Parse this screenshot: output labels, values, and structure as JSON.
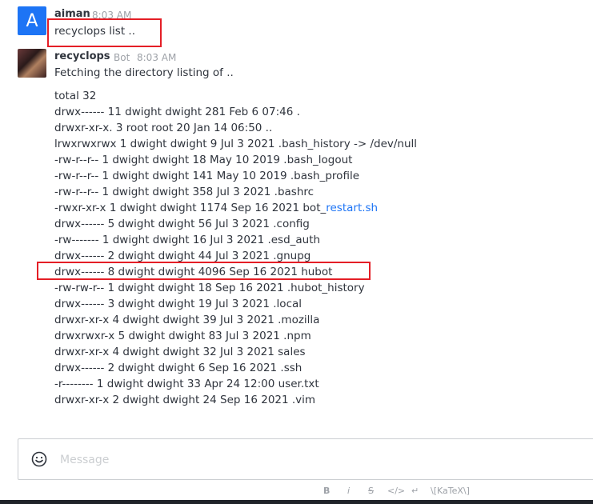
{
  "messages": [
    {
      "avatar_letter": "A",
      "username": "aiman",
      "time": "8:03 AM",
      "text": "recyclops list .."
    },
    {
      "username": "recyclops",
      "badge": "Bot",
      "time": "8:03 AM",
      "text": "Fetching the directory listing of ..",
      "listing": [
        "total 32",
        "drwx------ 11 dwight dwight 281 Feb 6 07:46 .",
        "drwxr-xr-x. 3 root root 20 Jan 14 06:50 ..",
        "lrwxrwxrwx 1 dwight dwight 9 Jul 3 2021 .bash_history -> /dev/null",
        "-rw-r--r-- 1 dwight dwight 18 May 10 2019 .bash_logout",
        "-rw-r--r-- 1 dwight dwight 141 May 10 2019 .bash_profile",
        "-rw-r--r-- 1 dwight dwight 358 Jul 3 2021 .bashrc",
        "-rwxr-xr-x 1 dwight dwight 1174 Sep 16 2021 bot_",
        "drwx------ 5 dwight dwight 56 Jul 3 2021 .config",
        "-rw------- 1 dwight dwight 16 Jul 3 2021 .esd_auth",
        "drwx------ 2 dwight dwight 44 Jul 3 2021 .gnupg",
        "drwx------ 8 dwight dwight 4096 Sep 16 2021 hubot",
        "-rw-rw-r-- 1 dwight dwight 18 Sep 16 2021 .hubot_history",
        "drwx------ 3 dwight dwight 19 Jul 3 2021 .local",
        "drwxr-xr-x 4 dwight dwight 39 Jul 3 2021 .mozilla",
        "drwxrwxr-x 5 dwight dwight 83 Jul 3 2021 .npm",
        "drwxr-xr-x 4 dwight dwight 32 Jul 3 2021 sales",
        "drwx------ 2 dwight dwight 6 Sep 16 2021 .ssh",
        "-r-------- 1 dwight dwight 33 Apr 24 12:00 user.txt",
        "drwxr-xr-x 2 dwight dwight 24 Sep 16 2021 .vim"
      ],
      "link_text": "restart.sh"
    }
  ],
  "composer": {
    "placeholder": "Message"
  },
  "toolbar": {
    "bold": "B",
    "italic": "i",
    "strike": "S",
    "code": "</>",
    "multiline": "↵",
    "katex": "\\[KaTeX\\]"
  },
  "colors": {
    "accent": "#1d74f5",
    "highlight": "#e41e26"
  }
}
